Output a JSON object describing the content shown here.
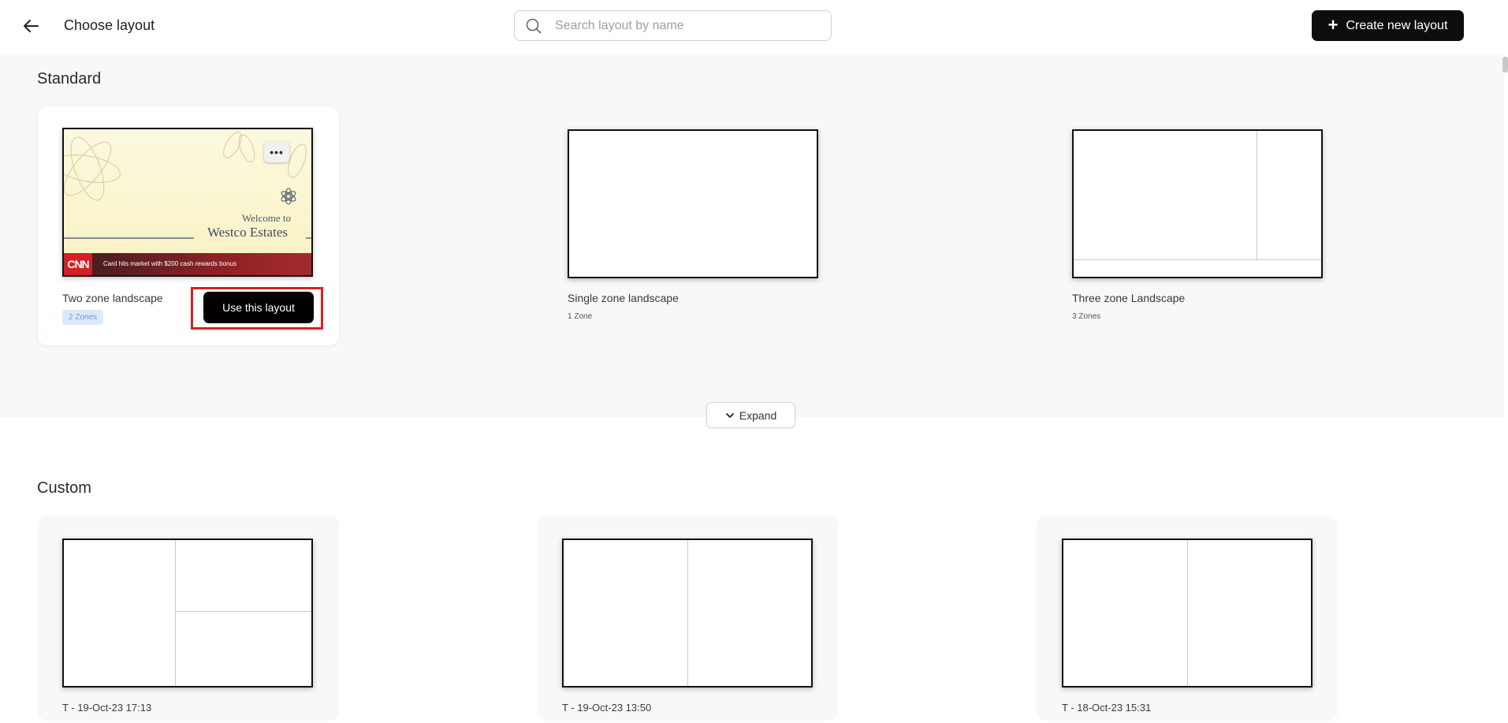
{
  "header": {
    "title": "Choose layout",
    "search_placeholder": "Search layout by name",
    "create_label": "Create new layout"
  },
  "standard": {
    "title": "Standard",
    "expand_label": "Expand",
    "layouts": [
      {
        "name": "Two zone landscape",
        "zones": "2 Zones",
        "use_label": "Use this layout",
        "preview": {
          "welcome": "Welcome to",
          "property": "Westco Estates",
          "ticker_brand": "CNN",
          "ticker_text": "Card hits market with $200 cash rewards bonus"
        }
      },
      {
        "name": "Single zone landscape",
        "zones": "1 Zone"
      },
      {
        "name": "Three zone Landscape",
        "zones": "3 Zones"
      }
    ]
  },
  "custom": {
    "title": "Custom",
    "layouts": [
      {
        "name": "T - 19-Oct-23 17:13"
      },
      {
        "name": "T - 19-Oct-23 13:50"
      },
      {
        "name": "T - 18-Oct-23 15:31"
      }
    ]
  },
  "colors": {
    "primary_button": "#0e0e0e",
    "highlight_outline": "#e01e24",
    "zone_badge_bg": "#dbe9fb",
    "section_bg": "#f7f8f8"
  },
  "icons": [
    "back-arrow-icon",
    "search-icon",
    "plus-icon",
    "chevron-down-icon",
    "more-options-icon"
  ]
}
